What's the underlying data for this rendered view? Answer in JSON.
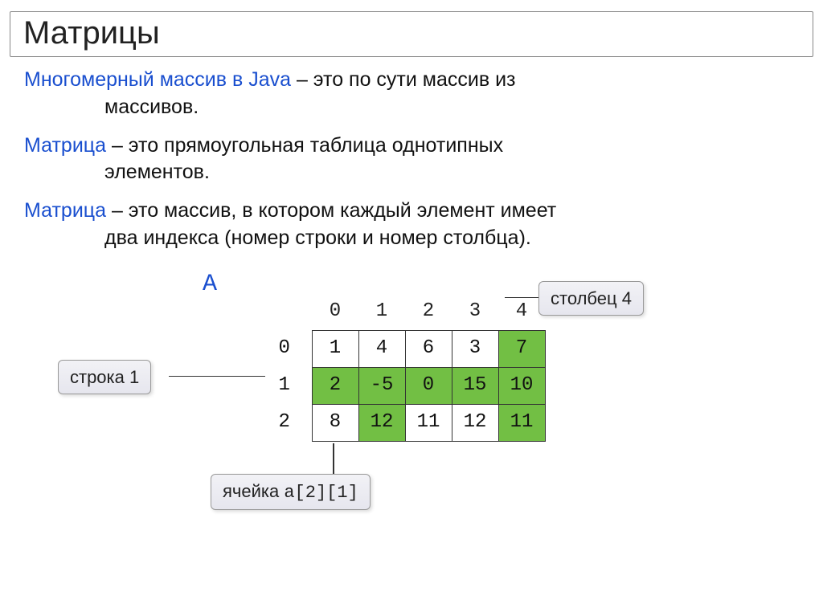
{
  "title": "Матрицы",
  "definitions": [
    {
      "term": "Многомерный массив в Java",
      "rest1": " – это по сути массив из",
      "rest2": "массивов."
    },
    {
      "term": "Матрица",
      "rest1": " – это прямоугольная таблица однотипных",
      "rest2": "элементов."
    },
    {
      "term": "Матрица",
      "rest1": " – это массив, в котором каждый элемент имеет",
      "rest2": "два индекса (номер строки и номер столбца)."
    }
  ],
  "matrix": {
    "name": "A",
    "col_headers": [
      "0",
      "1",
      "2",
      "3",
      "4"
    ],
    "row_headers": [
      "0",
      "1",
      "2"
    ],
    "rows": [
      [
        "1",
        "4",
        "6",
        "3",
        "7"
      ],
      [
        "2",
        "-5",
        "0",
        "15",
        "10"
      ],
      [
        "8",
        "12",
        "11",
        "12",
        "11"
      ]
    ]
  },
  "callouts": {
    "column": "столбец 4",
    "row": "строка 1",
    "cell_prefix": "ячейка ",
    "cell_code": "a[2][1]"
  }
}
